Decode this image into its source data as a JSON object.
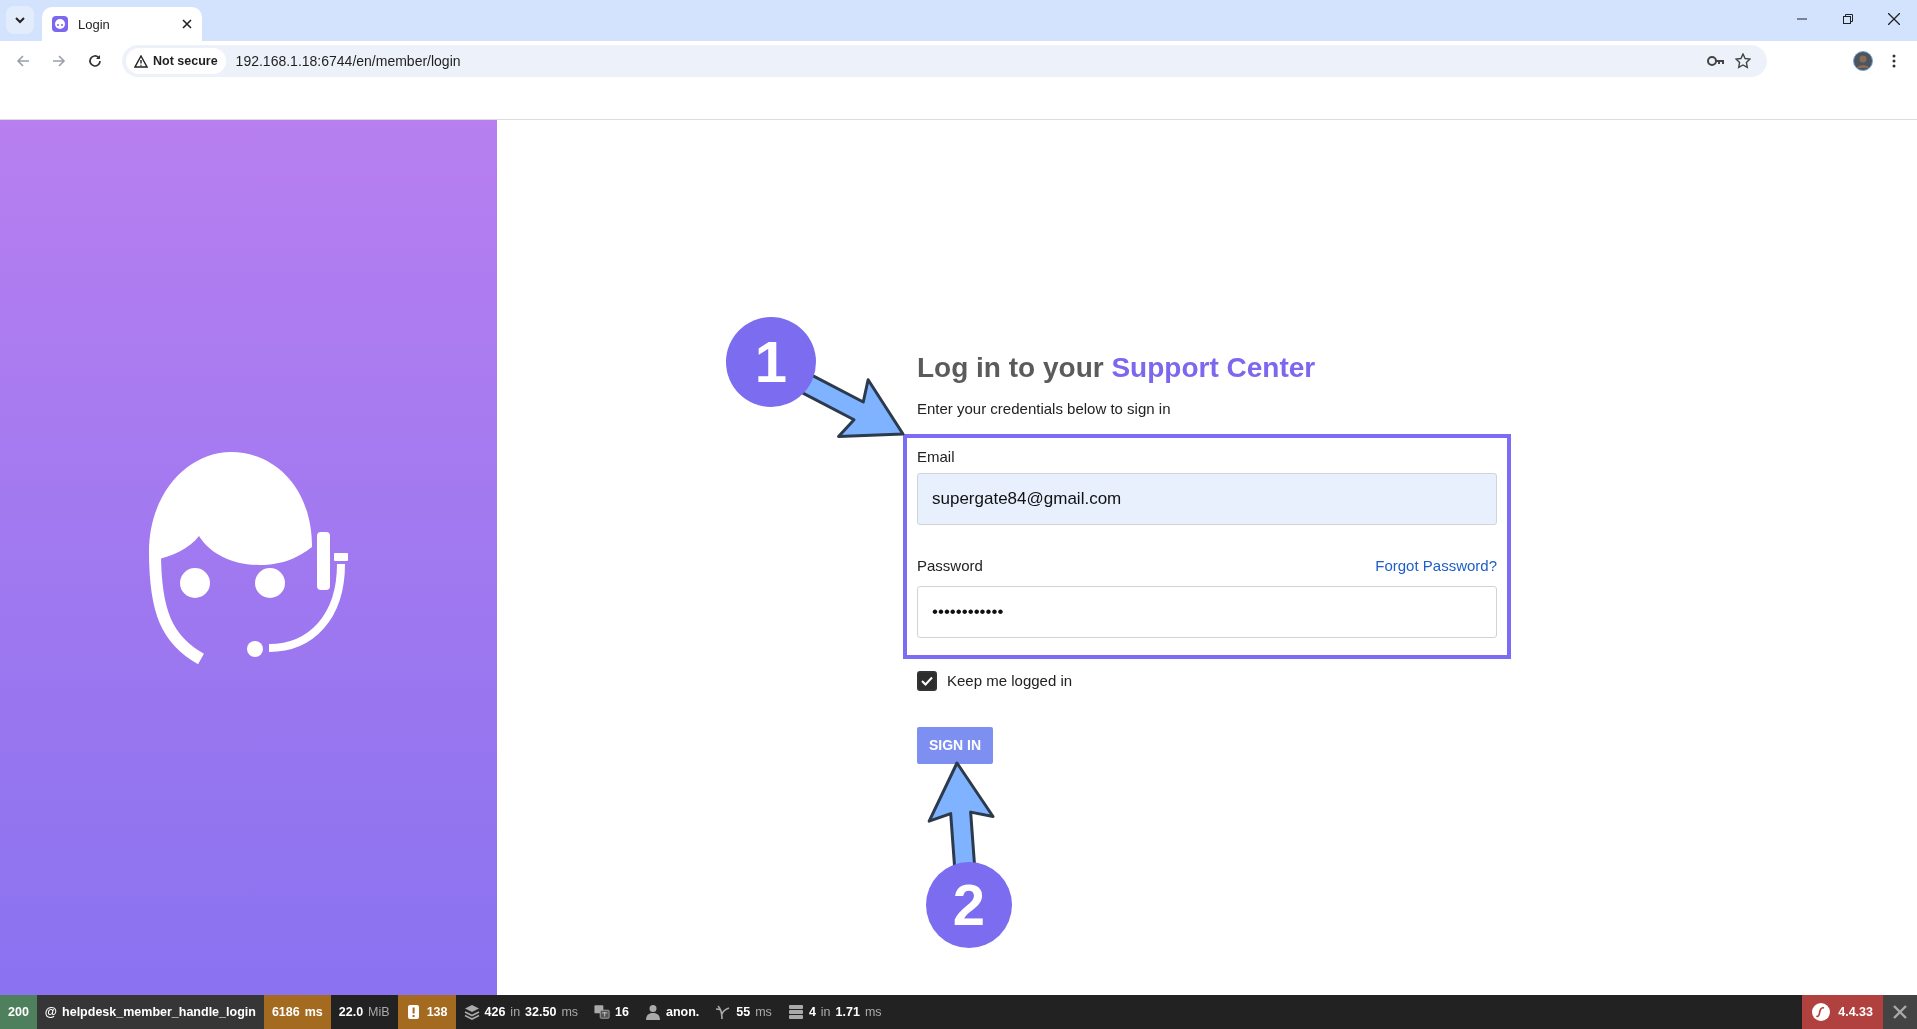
{
  "browser": {
    "tab": {
      "title": "Login",
      "selected": true
    },
    "security": "Not secure",
    "url": "192.168.1.18:6744/en/member/login"
  },
  "login": {
    "heading_start": "Log in to your",
    "heading_accent": "Support Center",
    "subtitle": "Enter your credentials below to sign in",
    "email": {
      "label": "Email",
      "value": "supergate84@gmail.com"
    },
    "password": {
      "label": "Password",
      "value": "••••••••••••",
      "link": "Forgot Password?"
    },
    "remember": {
      "label": "Keep me logged in",
      "checked": true
    },
    "submit": "SIGN IN"
  },
  "annotations": [
    {
      "label": "1"
    },
    {
      "label": "2"
    }
  ],
  "debug_toolbar": {
    "items": [
      {
        "kind": "status",
        "parts": [
          {
            "text": "200",
            "muted": false
          }
        ]
      },
      {
        "kind": "route",
        "parts": [
          {
            "text": "@",
            "muted": false
          },
          {
            "text": "helpdesk_member_handle_login",
            "muted": false
          }
        ]
      },
      {
        "kind": "time",
        "parts": [
          {
            "text": "6186",
            "muted": false
          },
          {
            "text": "ms",
            "muted": false
          }
        ]
      },
      {
        "kind": "memory",
        "parts": [
          {
            "text": "22.0",
            "muted": false
          },
          {
            "text": "MiB",
            "muted": true
          }
        ]
      },
      {
        "kind": "logs",
        "parts": [
          {
            "text": "138",
            "muted": false
          }
        ]
      },
      {
        "kind": "db",
        "parts": [
          {
            "text": "426",
            "muted": false
          },
          {
            "text": "in",
            "muted": true
          },
          {
            "text": "32.50",
            "muted": false
          },
          {
            "text": "ms",
            "muted": true
          }
        ]
      },
      {
        "kind": "translation",
        "parts": [
          {
            "text": "16",
            "muted": false
          }
        ]
      },
      {
        "kind": "user",
        "parts": [
          {
            "text": "anon.",
            "muted": false
          }
        ]
      },
      {
        "kind": "twig",
        "parts": [
          {
            "text": "55",
            "muted": false
          },
          {
            "text": "ms",
            "muted": true
          }
        ]
      },
      {
        "kind": "cache",
        "parts": [
          {
            "text": "4",
            "muted": false
          },
          {
            "text": "in",
            "muted": true
          },
          {
            "text": "1.71",
            "muted": false
          },
          {
            "text": "ms",
            "muted": true
          }
        ]
      }
    ],
    "version": "4.4.33"
  }
}
